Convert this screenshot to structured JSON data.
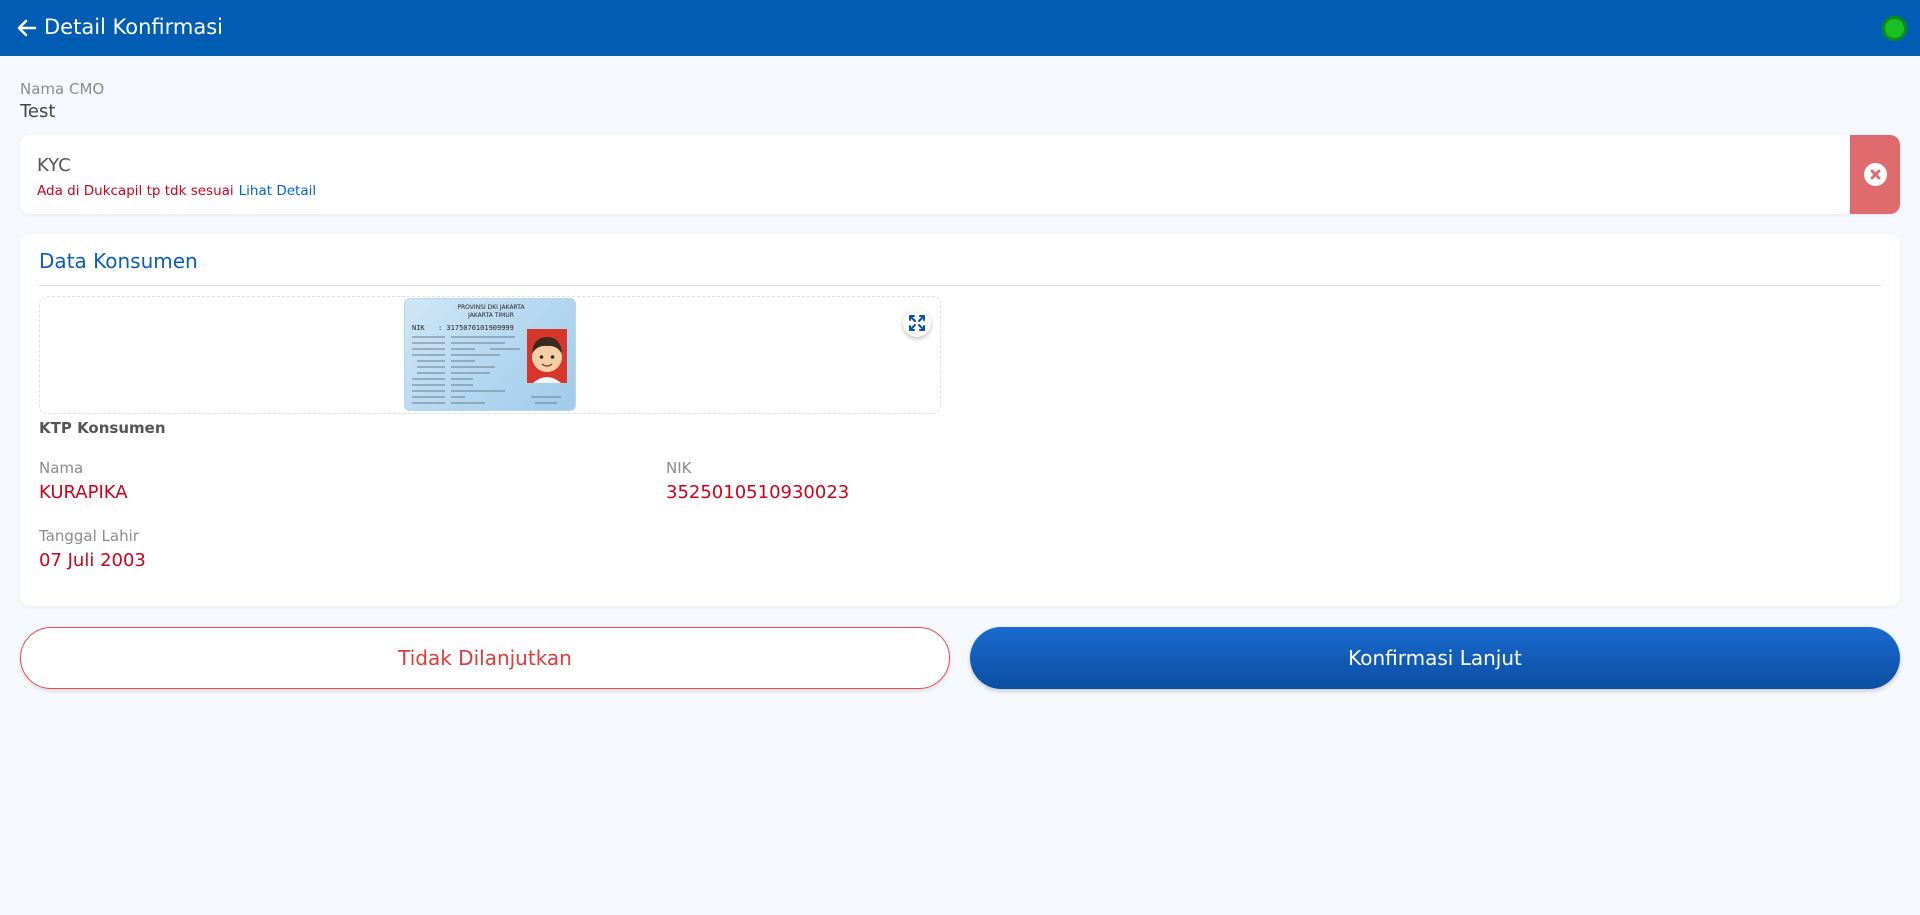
{
  "header": {
    "title": "Detail Konfirmasi",
    "back_icon": "arrow-left-icon",
    "status_color": "#1bbf21"
  },
  "cmo": {
    "label": "Nama CMO",
    "value": "Test"
  },
  "kyc": {
    "title": "KYC",
    "message": "Ada di Dukcapil tp tdk sesuai",
    "link": "Lihat Detail",
    "status_icon": "x-circle-icon",
    "status_color": "#e06b6f"
  },
  "consumer": {
    "section_title": "Data Konsumen",
    "ktp_caption": "KTP Konsumen",
    "expand_icon": "expand-icon",
    "ktp": {
      "province": "PROVINSI DKI JAKARTA",
      "city": "JAKARTA TIMUR",
      "nik_label": "NIK",
      "nik": ": 3175070101909999"
    },
    "fields": {
      "nama_label": "Nama",
      "nama_value": "KURAPIKA",
      "nik_label": "NIK",
      "nik_value": "3525010510930023",
      "tgl_label": "Tanggal Lahir",
      "tgl_value": "07 Juli 2003"
    }
  },
  "actions": {
    "reject_label": "Tidak Dilanjutkan",
    "confirm_label": "Konfirmasi Lanjut"
  }
}
